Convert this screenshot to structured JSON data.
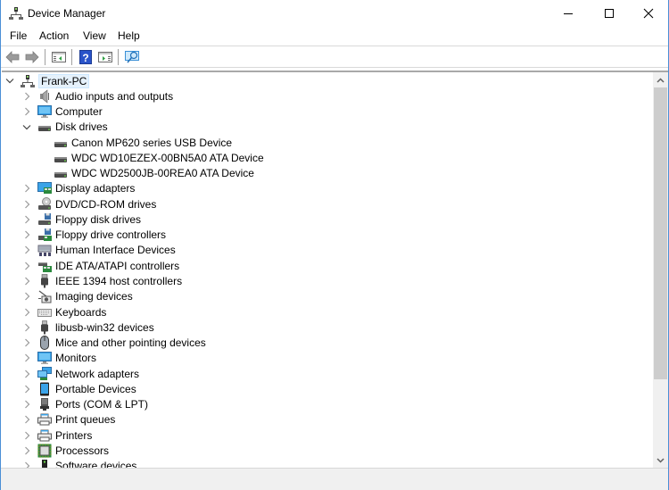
{
  "window": {
    "title": "Device Manager",
    "accent_color": "#4a8fd6",
    "controls": [
      "minimize-icon",
      "maximize-icon",
      "close-icon"
    ]
  },
  "menubar": {
    "items": [
      {
        "label": "File"
      },
      {
        "label": "Action"
      },
      {
        "label": "View"
      },
      {
        "label": "Help"
      }
    ]
  },
  "toolbar": {
    "buttons": [
      {
        "name": "back",
        "icon": "back-arrow-icon"
      },
      {
        "name": "forward",
        "icon": "forward-arrow-icon"
      },
      {
        "name": "show-hide-console-tree",
        "icon": "console-tree-icon"
      },
      {
        "name": "help",
        "icon": "help-icon"
      },
      {
        "name": "show-action-pane",
        "icon": "action-pane-icon"
      },
      {
        "name": "scan-hardware-changes",
        "icon": "scan-monitor-icon"
      }
    ]
  },
  "tree": {
    "root": {
      "label": "Frank-PC",
      "icon": "computer-network-icon",
      "expanded": true
    },
    "items": [
      {
        "label": "Audio inputs and outputs",
        "icon": "speaker-icon",
        "expanded": false
      },
      {
        "label": "Computer",
        "icon": "monitor-icon",
        "expanded": false
      },
      {
        "label": "Disk drives",
        "icon": "disk-drive-icon",
        "expanded": true,
        "children": [
          {
            "label": "Canon MP620 series USB Device",
            "icon": "disk-drive-icon"
          },
          {
            "label": "WDC WD10EZEX-00BN5A0 ATA Device",
            "icon": "disk-drive-icon"
          },
          {
            "label": "WDC WD2500JB-00REA0 ATA Device",
            "icon": "disk-drive-icon"
          }
        ]
      },
      {
        "label": "Display adapters",
        "icon": "display-adapter-icon",
        "expanded": false
      },
      {
        "label": "DVD/CD-ROM drives",
        "icon": "dvd-drive-icon",
        "expanded": false
      },
      {
        "label": "Floppy disk drives",
        "icon": "floppy-drive-icon",
        "expanded": false
      },
      {
        "label": "Floppy drive controllers",
        "icon": "floppy-controller-icon",
        "expanded": false
      },
      {
        "label": "Human Interface Devices",
        "icon": "hid-icon",
        "expanded": false
      },
      {
        "label": "IDE ATA/ATAPI controllers",
        "icon": "ide-controller-icon",
        "expanded": false
      },
      {
        "label": "IEEE 1394 host controllers",
        "icon": "ieee1394-icon",
        "expanded": false
      },
      {
        "label": "Imaging devices",
        "icon": "camera-icon",
        "expanded": false
      },
      {
        "label": "Keyboards",
        "icon": "keyboard-icon",
        "expanded": false
      },
      {
        "label": "libusb-win32 devices",
        "icon": "usb-plug-icon",
        "expanded": false
      },
      {
        "label": "Mice and other pointing devices",
        "icon": "mouse-icon",
        "expanded": false
      },
      {
        "label": "Monitors",
        "icon": "monitor-icon",
        "expanded": false
      },
      {
        "label": "Network adapters",
        "icon": "network-adapter-icon",
        "expanded": false
      },
      {
        "label": "Portable Devices",
        "icon": "portable-device-icon",
        "expanded": false
      },
      {
        "label": "Ports (COM & LPT)",
        "icon": "port-icon",
        "expanded": false
      },
      {
        "label": "Print queues",
        "icon": "printer-icon",
        "expanded": false
      },
      {
        "label": "Printers",
        "icon": "printer-icon",
        "expanded": false
      },
      {
        "label": "Processors",
        "icon": "processor-icon",
        "expanded": false
      },
      {
        "label": "Software devices",
        "icon": "software-device-icon",
        "expanded": false
      }
    ]
  },
  "scrollbar": {
    "position_fraction": 0.0,
    "visible_fraction": 0.8
  }
}
